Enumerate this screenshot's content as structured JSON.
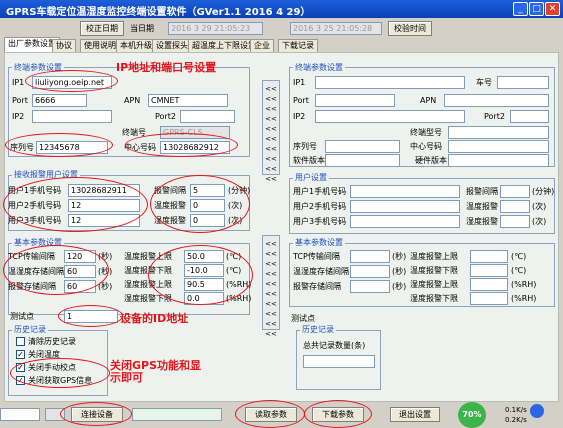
{
  "window": {
    "title": "GPRS车载定位温湿度监控终端设置软件（GVer1.1 2016 4 29）",
    "minimize": "_",
    "maximize": "□",
    "close": "✕"
  },
  "top": {
    "calibrate_btn": "校正日期",
    "date_label": "当日期",
    "device_date": "2016 3 29 21:05:23",
    "pc_date": "2016 3 25 21:05:28",
    "read_time_btn": "校验时间"
  },
  "tabs": [
    "出厂参数设置",
    "协议",
    "使用说明",
    "本机升级",
    "设置探头",
    "超温度上下限设置",
    "企业",
    "下载记录"
  ],
  "left": {
    "terminal_header": "终端参数设置",
    "ip_label": "IP1",
    "ip_value": "liuliyong.oeip.net",
    "port_label": "Port",
    "port_value": "6666",
    "apn_label": "APN",
    "apn_value": "CMNET",
    "ip2_label": "IP2",
    "port2_label": "Port2",
    "term_no_label": "终端号",
    "term_no_value": "GPRS-CLS",
    "serial_label": "序列号",
    "serial_value": "12345678",
    "center_label": "中心号码",
    "center_value": "13028682912",
    "alarm_header": "接收报警用户设置",
    "users": [
      {
        "label": "用户1手机号码",
        "value": "13028682911"
      },
      {
        "label": "用户2手机号码",
        "value": "12"
      },
      {
        "label": "用户3手机号码",
        "value": "12"
      }
    ],
    "alarm_fields": [
      {
        "label": "报警间隔",
        "value": "5",
        "unit": "(分钟)"
      },
      {
        "label": "温度报警",
        "value": "0",
        "unit": "(次)"
      },
      {
        "label": "湿度报警",
        "value": "0",
        "unit": "(次)"
      }
    ],
    "basic_header": "基本参数设置",
    "basic_left": [
      {
        "label": "TCP传输间隔",
        "value": "120",
        "unit": "(秒)"
      },
      {
        "label": "温湿度存储间隔",
        "value": "60",
        "unit": "(秒)"
      },
      {
        "label": "报警存储间隔",
        "value": "60",
        "unit": "(秒)"
      }
    ],
    "basic_right": [
      {
        "label": "温度报警上限",
        "value": "50.0",
        "unit": "(℃)"
      },
      {
        "label": "温度报警下限",
        "value": "-10.0",
        "unit": "(℃)"
      },
      {
        "label": "湿度报警上限",
        "value": "90.5",
        "unit": "(%RH)"
      },
      {
        "label": "湿度报警下限",
        "value": "0.0",
        "unit": "(%RH)"
      }
    ],
    "test_label": "测试点",
    "test_value": "1",
    "history_header": "历史记录",
    "checks": [
      {
        "label": "清除历史记录",
        "checked": false
      },
      {
        "label": "关闭温度",
        "checked": true
      },
      {
        "label": "关闭手动校点",
        "checked": true
      },
      {
        "label": "关闭获取GPS信息",
        "checked": true
      }
    ]
  },
  "right": {
    "terminal_header": "终端参数设置",
    "ip_label": "IP1",
    "car_label": "车号",
    "port_label": "Port",
    "apn_label": "APN",
    "ip2_label": "IP2",
    "port2_label": "Port2",
    "term_no_label": "终端型号",
    "serial_label": "序列号",
    "center_label": "中心号码",
    "sw_label": "软件版本",
    "hw_label": "硬件版本",
    "user_header": "用户设置",
    "users": [
      {
        "label": "用户1手机号码",
        "tail": "报警间隔",
        "unit": "(分钟)"
      },
      {
        "label": "用户2手机号码",
        "tail": "温度报警",
        "unit": "(次)"
      },
      {
        "label": "用户3手机号码",
        "tail": "湿度报警",
        "unit": "(次)"
      }
    ],
    "basic_header": "基本参数设置",
    "basic_left": [
      {
        "label": "TCP传输间隔",
        "unit": "(秒)"
      },
      {
        "label": "温湿度存储间隔",
        "unit": "(秒)"
      },
      {
        "label": "报警存储间隔",
        "unit": "(秒)"
      }
    ],
    "basic_right": [
      {
        "label": "温度报警上限",
        "unit": "(℃)"
      },
      {
        "label": "温度报警下限",
        "unit": "(℃)"
      },
      {
        "label": "湿度报警上限",
        "unit": "(%RH)"
      },
      {
        "label": "湿度报警下限",
        "unit": "(%RH)"
      }
    ],
    "test_label": "测试点",
    "history_header": "历史记录",
    "history_count_label": "总共记录数量(条)"
  },
  "arrows": "<<<< <<<< <<<< <<<< <<<<",
  "arrows2": "<<<< <<<< <<<< <<<< <<<<",
  "annotations": {
    "ip": "IP地址和端口号设置",
    "device_id": "设备的ID地址",
    "gps": "关闭GPS功能和显示即可"
  },
  "status": {
    "connect_btn": "连接设备",
    "read_btn": "读取参数",
    "download_btn": "下载参数",
    "exit_btn": "退出设置",
    "cpu": "70%",
    "speed1": "0.1K/s",
    "speed2": "0.2K/s"
  }
}
